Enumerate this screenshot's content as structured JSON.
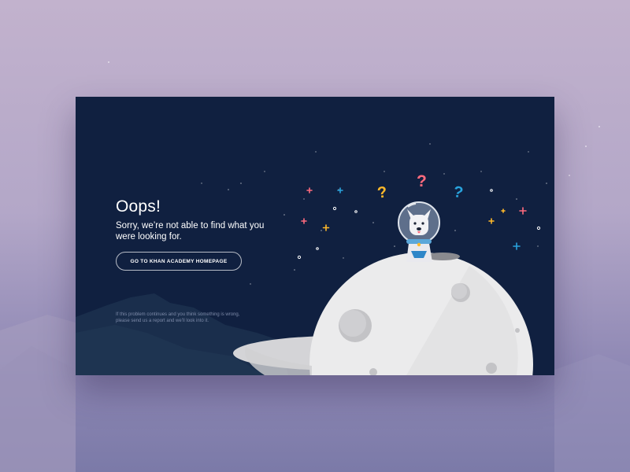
{
  "page": {
    "title": "Oops!",
    "message": "Sorry, we’re not able to find what you were looking for.",
    "button_label": "GO TO KHAN ACADEMY HOMEPAGE",
    "footnote": "If this problem continues and you think something is wrong, please send us a report and we’ll look into it."
  },
  "illustration": {
    "question_marks": [
      "?",
      "?",
      "?"
    ],
    "question_mark_colors": [
      "#ff6b7e",
      "#ffb92a",
      "#29a3dd"
    ],
    "plus_colors": [
      "#ff6b7e",
      "#29a3dd",
      "#ffb92a"
    ]
  },
  "colors": {
    "card_background": "#102040",
    "moon": "#ebebec",
    "crater": "#c8c8ca",
    "text": "#ffffff",
    "muted_text": "#7d8aa8"
  }
}
